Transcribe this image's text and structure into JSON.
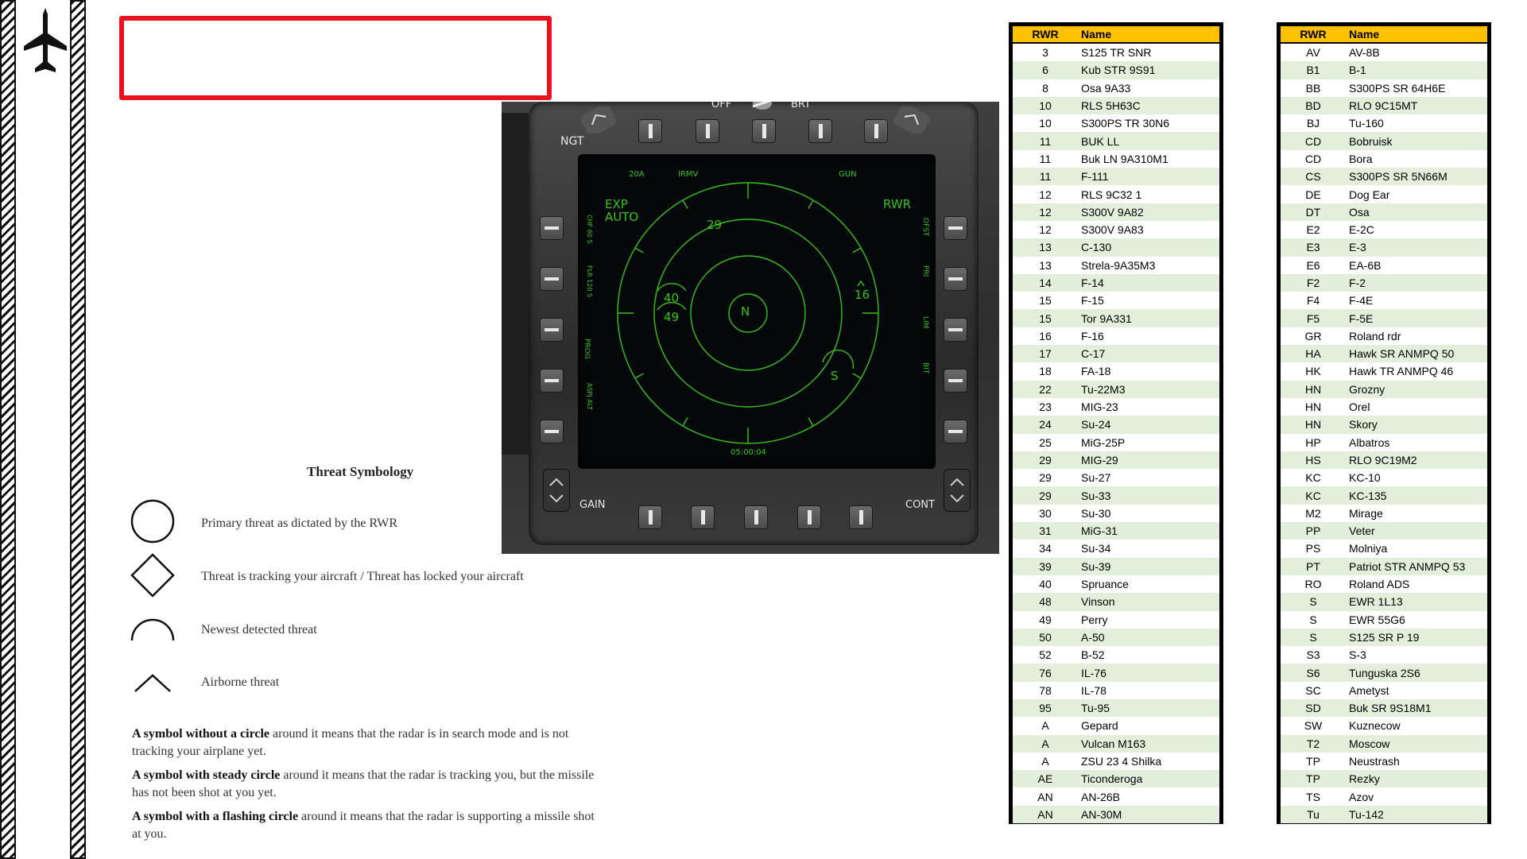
{
  "header": {
    "title": ""
  },
  "mfd": {
    "top_labels": {
      "off": "OFF",
      "brt": "BRT",
      "ngt": "NGT"
    },
    "bottom_labels": {
      "gain": "GAIN",
      "cont": "CONT"
    },
    "screen": {
      "mode": "RWR",
      "exp_line1": "EXP",
      "exp_line2": "AUTO",
      "top_options": [
        "20A",
        "IRMV",
        "GUN"
      ],
      "left_options": [
        "CHF 60 S",
        "FLR 120 S",
        "PROG",
        "ASPJ ALT"
      ],
      "right_options": [
        "OFST",
        "PRI",
        "LIM",
        "BIT"
      ],
      "center": "N",
      "contacts": [
        "29",
        "40",
        "49",
        "16",
        "S"
      ],
      "clock": "05:00:04"
    }
  },
  "symbology": {
    "title": "Threat Symbology",
    "items": [
      {
        "icon": "circle-icon",
        "desc": "Primary threat as dictated by the RWR"
      },
      {
        "icon": "diamond-icon",
        "desc": "Threat is tracking your aircraft / Threat has locked your aircraft"
      },
      {
        "icon": "semicircle-icon",
        "desc": "Newest detected threat"
      },
      {
        "icon": "chevron-icon",
        "desc": "Airborne threat"
      }
    ],
    "notes": [
      {
        "bold": "A symbol without a circle",
        "text": " around it means that the radar is in search mode and is not tracking your airplane yet."
      },
      {
        "bold": "A symbol with steady circle",
        "text": " around it means that the radar is tracking you, but the missile has not been shot at you yet."
      },
      {
        "bold": "A symbol with a flashing circle",
        "text": " around it means that the radar is supporting a missile shot at you."
      }
    ]
  },
  "tables": {
    "headers": {
      "code": "RWR",
      "name": "Name"
    },
    "table1": [
      [
        "3",
        "S125 TR SNR"
      ],
      [
        "6",
        "Kub STR 9S91"
      ],
      [
        "8",
        "Osa 9A33"
      ],
      [
        "10",
        "RLS 5H63C"
      ],
      [
        "10",
        "S300PS TR 30N6"
      ],
      [
        "11",
        "BUK LL"
      ],
      [
        "11",
        "Buk LN 9A310M1"
      ],
      [
        "11",
        "F-111"
      ],
      [
        "12",
        "RLS 9C32 1"
      ],
      [
        "12",
        "S300V 9A82"
      ],
      [
        "12",
        "S300V 9A83"
      ],
      [
        "13",
        "C-130"
      ],
      [
        "13",
        "Strela-9A35M3"
      ],
      [
        "14",
        "F-14"
      ],
      [
        "15",
        "F-15"
      ],
      [
        "15",
        "Tor 9A331"
      ],
      [
        "16",
        "F-16"
      ],
      [
        "17",
        "C-17"
      ],
      [
        "18",
        "FA-18"
      ],
      [
        "22",
        "Tu-22M3"
      ],
      [
        "23",
        "MIG-23"
      ],
      [
        "24",
        "Su-24"
      ],
      [
        "25",
        "MiG-25P"
      ],
      [
        "29",
        "MIG-29"
      ],
      [
        "29",
        "Su-27"
      ],
      [
        "29",
        "Su-33"
      ],
      [
        "30",
        "Su-30"
      ],
      [
        "31",
        "MiG-31"
      ],
      [
        "34",
        "Su-34"
      ],
      [
        "39",
        "Su-39"
      ],
      [
        "40",
        "Spruance"
      ],
      [
        "48",
        "Vinson"
      ],
      [
        "49",
        "Perry"
      ],
      [
        "50",
        "A-50"
      ],
      [
        "52",
        "B-52"
      ],
      [
        "76",
        "IL-76"
      ],
      [
        "78",
        "IL-78"
      ],
      [
        "95",
        "Tu-95"
      ],
      [
        "A",
        "Gepard"
      ],
      [
        "A",
        "Vulcan M163"
      ],
      [
        "A",
        "ZSU 23 4 Shilka"
      ],
      [
        "AE",
        "Ticonderoga"
      ],
      [
        "AN",
        "AN-26B"
      ],
      [
        "AN",
        "AN-30M"
      ]
    ],
    "table2": [
      [
        "AV",
        "AV-8B"
      ],
      [
        "B1",
        "B-1"
      ],
      [
        "BB",
        "S300PS SR 64H6E"
      ],
      [
        "BD",
        "RLO 9C15MT"
      ],
      [
        "BJ",
        "Tu-160"
      ],
      [
        "CD",
        "Bobruisk"
      ],
      [
        "CD",
        "Bora"
      ],
      [
        "CS",
        "S300PS SR 5N66M"
      ],
      [
        "DE",
        "Dog Ear"
      ],
      [
        "DT",
        "Osa"
      ],
      [
        "E2",
        "E-2C"
      ],
      [
        "E3",
        "E-3"
      ],
      [
        "E6",
        "EA-6B"
      ],
      [
        "F2",
        "F-2"
      ],
      [
        "F4",
        "F-4E"
      ],
      [
        "F5",
        "F-5E"
      ],
      [
        "GR",
        "Roland rdr"
      ],
      [
        "HA",
        "Hawk SR ANMPQ 50"
      ],
      [
        "HK",
        "Hawk TR ANMPQ 46"
      ],
      [
        "HN",
        "Grozny"
      ],
      [
        "HN",
        "Orel"
      ],
      [
        "HN",
        "Skory"
      ],
      [
        "HP",
        "Albatros"
      ],
      [
        "HS",
        "RLO 9C19M2"
      ],
      [
        "KC",
        "KC-10"
      ],
      [
        "KC",
        "KC-135"
      ],
      [
        "M2",
        "Mirage"
      ],
      [
        "PP",
        "Veter"
      ],
      [
        "PS",
        "Molniya"
      ],
      [
        "PT",
        "Patriot STR ANMPQ 53"
      ],
      [
        "RO",
        "Roland ADS"
      ],
      [
        "S",
        "EWR 1L13"
      ],
      [
        "S",
        "EWR 55G6"
      ],
      [
        "S",
        "S125 SR P 19"
      ],
      [
        "S3",
        "S-3"
      ],
      [
        "S6",
        "Tunguska 2S6"
      ],
      [
        "SC",
        "Ametyst"
      ],
      [
        "SD",
        "Buk SR 9S18M1"
      ],
      [
        "SW",
        "Kuznecow"
      ],
      [
        "T2",
        "Moscow"
      ],
      [
        "TP",
        "Neustrash"
      ],
      [
        "TP",
        "Rezky"
      ],
      [
        "TS",
        "Azov"
      ],
      [
        "Tu",
        "Tu-142"
      ]
    ]
  }
}
